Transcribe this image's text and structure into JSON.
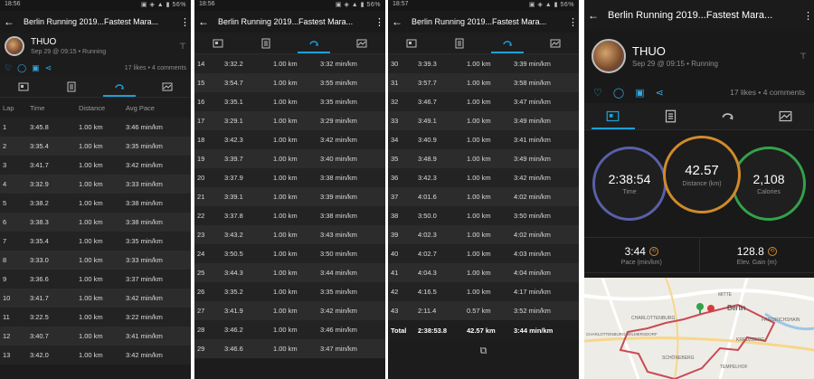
{
  "activity_title": "Berlin Running 2019...Fastest Mara...",
  "colors": {
    "accent": "#1e9fd8",
    "time_ring": "#5b5fa8",
    "distance_ring": "#d08a2c",
    "calories_ring": "#33a24a",
    "route": "#c94a55"
  },
  "panel1": {
    "status": {
      "time": "18:56",
      "right": "▣ ◈ ▲ ▮ 56%"
    },
    "profile": {
      "name": "THUO",
      "subtitle": "Sep 29 @ 09:15 • Running"
    },
    "social_counts": "17 likes • 4 comments",
    "columns": [
      "Lap",
      "Time",
      "Distance",
      "Avg Pace"
    ],
    "laps": [
      [
        "1",
        "3:45.8",
        "1.00 km",
        "3:46 min/km"
      ],
      [
        "2",
        "3:35.4",
        "1.00 km",
        "3:35 min/km"
      ],
      [
        "3",
        "3:41.7",
        "1.00 km",
        "3:42 min/km"
      ],
      [
        "4",
        "3:32.9",
        "1.00 km",
        "3:33 min/km"
      ],
      [
        "5",
        "3:38.2",
        "1.00 km",
        "3:38 min/km"
      ],
      [
        "6",
        "3:38.3",
        "1.00 km",
        "3:38 min/km"
      ],
      [
        "7",
        "3:35.4",
        "1.00 km",
        "3:35 min/km"
      ],
      [
        "8",
        "3:33.0",
        "1.00 km",
        "3:33 min/km"
      ],
      [
        "9",
        "3:36.6",
        "1.00 km",
        "3:37 min/km"
      ],
      [
        "10",
        "3:41.7",
        "1.00 km",
        "3:42 min/km"
      ],
      [
        "11",
        "3:22.5",
        "1.00 km",
        "3:22 min/km"
      ],
      [
        "12",
        "3:40.7",
        "1.00 km",
        "3:41 min/km"
      ],
      [
        "13",
        "3:42.0",
        "1.00 km",
        "3:42 min/km"
      ]
    ]
  },
  "panel2": {
    "status": {
      "time": "18:56",
      "right": "▣ ◈ ▲ ▮ 56%"
    },
    "laps": [
      [
        "14",
        "3:32.2",
        "1.00 km",
        "3:32 min/km"
      ],
      [
        "15",
        "3:54.7",
        "1.00 km",
        "3:55 min/km"
      ],
      [
        "16",
        "3:35.1",
        "1.00 km",
        "3:35 min/km"
      ],
      [
        "17",
        "3:29.1",
        "1.00 km",
        "3:29 min/km"
      ],
      [
        "18",
        "3:42.3",
        "1.00 km",
        "3:42 min/km"
      ],
      [
        "19",
        "3:39.7",
        "1.00 km",
        "3:40 min/km"
      ],
      [
        "20",
        "3:37.9",
        "1.00 km",
        "3:38 min/km"
      ],
      [
        "21",
        "3:39.1",
        "1.00 km",
        "3:39 min/km"
      ],
      [
        "22",
        "3:37.8",
        "1.00 km",
        "3:38 min/km"
      ],
      [
        "23",
        "3:43.2",
        "1.00 km",
        "3:43 min/km"
      ],
      [
        "24",
        "3:50.5",
        "1.00 km",
        "3:50 min/km"
      ],
      [
        "25",
        "3:44.3",
        "1.00 km",
        "3:44 min/km"
      ],
      [
        "26",
        "3:35.2",
        "1.00 km",
        "3:35 min/km"
      ],
      [
        "27",
        "3:41.9",
        "1.00 km",
        "3:42 min/km"
      ],
      [
        "28",
        "3:46.2",
        "1.00 km",
        "3:46 min/km"
      ],
      [
        "29",
        "3:46.6",
        "1.00 km",
        "3:47 min/km"
      ]
    ]
  },
  "panel3": {
    "status": {
      "time": "18:57",
      "right": "▣ ◈ ▲ ▮ 56%"
    },
    "laps": [
      [
        "30",
        "3:39.3",
        "1.00 km",
        "3:39 min/km"
      ],
      [
        "31",
        "3:57.7",
        "1.00 km",
        "3:58 min/km"
      ],
      [
        "32",
        "3:46.7",
        "1.00 km",
        "3:47 min/km"
      ],
      [
        "33",
        "3:49.1",
        "1.00 km",
        "3:49 min/km"
      ],
      [
        "34",
        "3:40.9",
        "1.00 km",
        "3:41 min/km"
      ],
      [
        "35",
        "3:48.9",
        "1.00 km",
        "3:49 min/km"
      ],
      [
        "36",
        "3:42.3",
        "1.00 km",
        "3:42 min/km"
      ],
      [
        "37",
        "4:01.6",
        "1.00 km",
        "4:02 min/km"
      ],
      [
        "38",
        "3:50.0",
        "1.00 km",
        "3:50 min/km"
      ],
      [
        "39",
        "4:02.3",
        "1.00 km",
        "4:02 min/km"
      ],
      [
        "40",
        "4:02.7",
        "1.00 km",
        "4:03 min/km"
      ],
      [
        "41",
        "4:04.3",
        "1.00 km",
        "4:04 min/km"
      ],
      [
        "42",
        "4:16.5",
        "1.00 km",
        "4:17 min/km"
      ],
      [
        "43",
        "2:11.4",
        "0.57 km",
        "3:52 min/km"
      ]
    ],
    "total": [
      "Total",
      "2:38:53.8",
      "42.57 km",
      "3:44 min/km"
    ]
  },
  "panel4": {
    "profile": {
      "name": "THUO",
      "subtitle": "Sep 29 @ 09:15 • Running"
    },
    "social_counts": "17 likes • 4 comments",
    "time": {
      "value": "2:38:54",
      "label": "Time"
    },
    "distance": {
      "value": "42.57",
      "label": "Distance (km)"
    },
    "calories": {
      "value": "2,108",
      "label": "Calories"
    },
    "pace": {
      "value": "3:44",
      "label": "Pace (min/km)"
    },
    "elev": {
      "value": "128.8",
      "label": "Elev. Gain (m)"
    },
    "map_labels": {
      "charlottenburg": "CHARLOTTENBURG",
      "berlin": "Berlin",
      "schoneberg": "SCHÖNEBERG",
      "wilmersdorf": "CHARLOTTENBURG-WILMERSDORF",
      "kreuzberg": "KREUZBERG",
      "friedrichshain": "FRIEDRICHSHAIN",
      "mitte": "MITTE",
      "tempelhof": "TEMPELHOF"
    }
  }
}
